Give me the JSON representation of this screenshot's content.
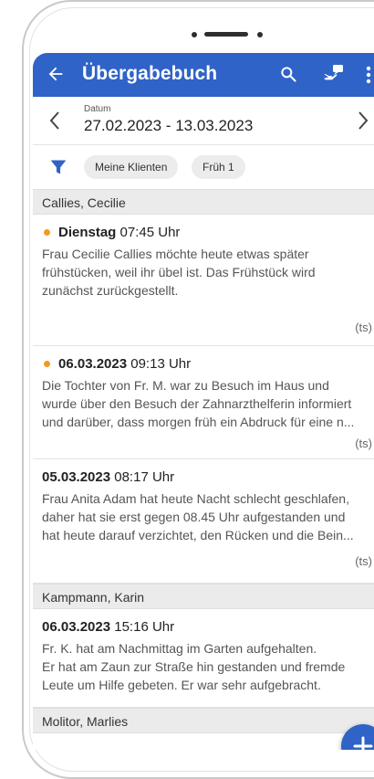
{
  "appbar": {
    "title": "Übergabebuch",
    "color": "#2f63c7",
    "icons": [
      "back-arrow-icon",
      "search-icon",
      "handover-icon",
      "more-vert-icon"
    ]
  },
  "datebar": {
    "caption": "Datum",
    "range": "27.02.2023 - 13.03.2023"
  },
  "filter": {
    "chips": [
      "Meine Klienten",
      "Früh 1"
    ]
  },
  "sections": [
    {
      "name": "Callies, Cecilie",
      "entries": [
        {
          "date": "Dienstag",
          "time": "07:45 Uhr",
          "unread": true,
          "lines": [
            "Frau Cecilie Callies möchte heute etwas später",
            "frühstücken, weil ihr übel ist. Das Frühstück wird",
            "zunächst zurückgestellt."
          ],
          "signature": "(ts)"
        },
        {
          "date": "06.03.2023",
          "time": "09:13 Uhr",
          "unread": true,
          "lines": [
            "Die Tochter von Fr. M. war zu Besuch im Haus und",
            "wurde über den Besuch der Zahnarzthelferin informiert",
            "und darüber, dass morgen früh ein Abdruck für eine n..."
          ],
          "signature": "(ts)"
        },
        {
          "date": "05.03.2023",
          "time": "08:17 Uhr",
          "unread": false,
          "lines": [
            "Frau Anita Adam hat heute Nacht schlecht geschlafen,",
            "daher hat sie erst gegen 08.45 Uhr aufgestanden und",
            "hat heute darauf verzichtet, den Rücken und die Bein..."
          ],
          "signature": "(ts)"
        }
      ]
    },
    {
      "name": "Kampmann, Karin",
      "entries": [
        {
          "date": "06.03.2023",
          "time": "15:16 Uhr",
          "unread": false,
          "lines": [
            "Fr. K. hat am Nachmittag im Garten aufgehalten.",
            "Er hat am Zaun zur Straße hin gestanden und fremde",
            "Leute um Hilfe gebeten. Er war sehr aufgebracht."
          ],
          "signature": ""
        }
      ]
    },
    {
      "name": "Molitor, Marlies",
      "entries": []
    }
  ],
  "fab": {
    "icon": "plus-icon"
  }
}
